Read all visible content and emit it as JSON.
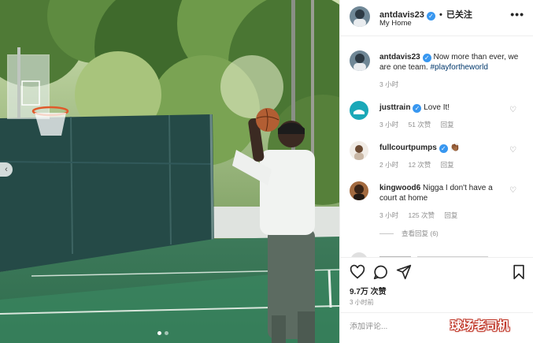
{
  "post": {
    "username": "antdavis23",
    "follow_status": "已关注",
    "separator": "•",
    "location": "My Home",
    "more_label": "•••",
    "caption_text": "Now more than ever, we are one team.",
    "caption_hashtag": "#playfortheworld",
    "caption_time": "3 小时",
    "likes": "9.7万 次赞",
    "posted_time": "3 小时前",
    "add_comment_placeholder": "添加评论..."
  },
  "comments": [
    {
      "username": "justtrain",
      "verified": true,
      "text": "Love It!",
      "time": "3 小时",
      "likes": "51 次赞",
      "reply": "回复"
    },
    {
      "username": "fullcourtpumps",
      "verified": true,
      "text": "👏🏾",
      "time": "2 小时",
      "likes": "12 次赞",
      "reply": "回复"
    },
    {
      "username": "kingwood6",
      "verified": false,
      "text": "Nigga I don't have a court at home",
      "time": "3 小时",
      "likes": "125 次赞",
      "reply": "回复"
    }
  ],
  "view_replies": "查看回复 (6)",
  "carousel": {
    "prev_label": "‹"
  },
  "watermark": "球场老司机",
  "icons": {
    "verified": "verified-badge-icon",
    "heart": "heart-icon",
    "comment": "comment-bubble-icon",
    "share": "send-paper-plane-icon",
    "save": "bookmark-icon",
    "more": "more-options-icon"
  },
  "colors": {
    "verified": "#3897f0",
    "hashtag": "#00376b",
    "muted": "#8e8e8e",
    "text": "#262626",
    "watermark_outline": "#c0392b"
  }
}
